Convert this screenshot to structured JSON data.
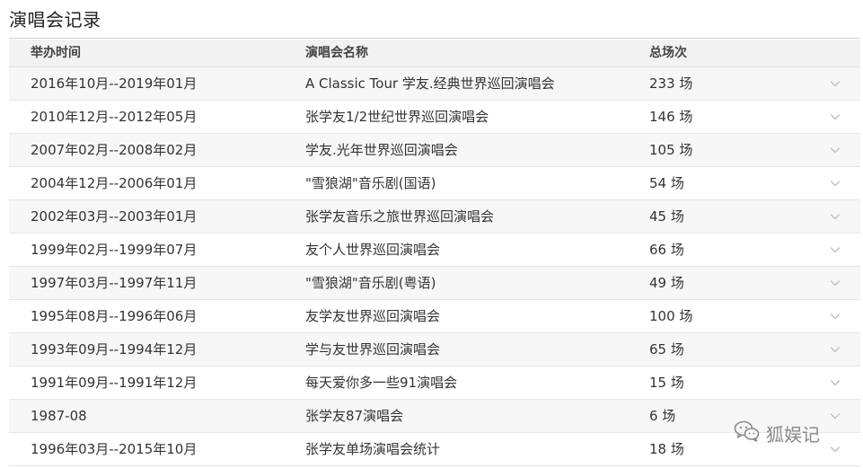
{
  "section": {
    "title": "演唱会记录"
  },
  "table": {
    "headers": {
      "date": "举办时间",
      "name": "演唱会名称",
      "count": "总场次"
    },
    "rows": [
      {
        "date": "2016年10月--2019年01月",
        "name": "A Classic Tour 学友.经典世界巡回演唱会",
        "count": "233 场"
      },
      {
        "date": "2010年12月--2012年05月",
        "name": "张学友1/2世纪世界巡回演唱会",
        "count": "146 场"
      },
      {
        "date": "2007年02月--2008年02月",
        "name": "学友.光年世界巡回演唱会",
        "count": "105 场"
      },
      {
        "date": "2004年12月--2006年01月",
        "name": "\"雪狼湖\"音乐剧(国语)",
        "count": "54 场"
      },
      {
        "date": "2002年03月--2003年01月",
        "name": "张学友音乐之旅世界巡回演唱会",
        "count": "45 场"
      },
      {
        "date": "1999年02月--1999年07月",
        "name": "友个人世界巡回演唱会",
        "count": "66 场"
      },
      {
        "date": "1997年03月--1997年11月",
        "name": "\"雪狼湖\"音乐剧(粤语)",
        "count": "49 场"
      },
      {
        "date": "1995年08月--1996年06月",
        "name": "友学友世界巡回演唱会",
        "count": "100 场"
      },
      {
        "date": "1993年09月--1994年12月",
        "name": "学与友世界巡回演唱会",
        "count": "65 场"
      },
      {
        "date": "1991年09月--1991年12月",
        "name": "每天爱你多一些91演唱会",
        "count": "15 场"
      },
      {
        "date": "1987-08",
        "name": "张学友87演唱会",
        "count": "6 场"
      },
      {
        "date": "1996年03月--2015年10月",
        "name": "张学友单场演唱会统计",
        "count": "18 场"
      }
    ]
  },
  "watermark": {
    "text": "狐娱记",
    "icon": "wechat-icon"
  },
  "colors": {
    "header_bg": "#f2f2f2",
    "row_alt_bg": "#f7f7f7",
    "chevron": "#b8c4cc",
    "divider": "#e6e6e6"
  }
}
